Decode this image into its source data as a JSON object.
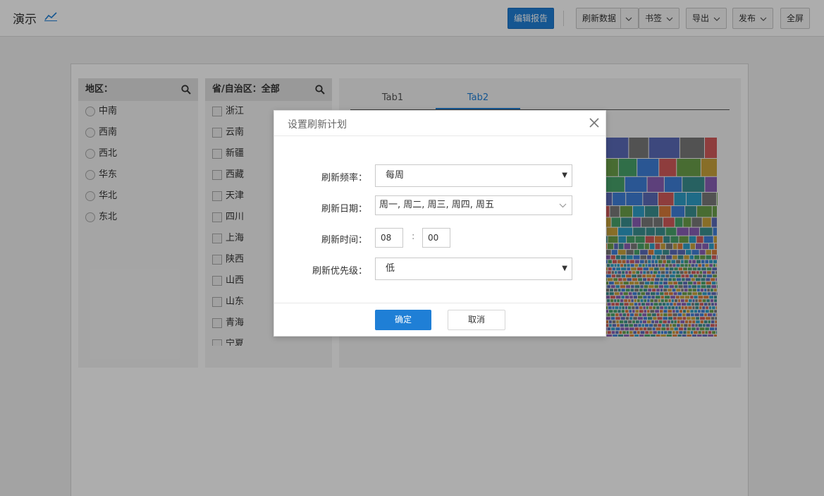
{
  "header": {
    "title": "演示",
    "buttons": {
      "edit_report": "编辑报告",
      "refresh_data": "刷新数据",
      "bookmark": "书签",
      "export": "导出",
      "publish": "发布",
      "fullscreen": "全屏"
    }
  },
  "filters": {
    "region": {
      "title": "地区：",
      "options": [
        "中南",
        "西南",
        "西北",
        "华东",
        "华北",
        "东北"
      ]
    },
    "province": {
      "title": "省/自治区：全部",
      "options": [
        "浙江",
        "云南",
        "新疆",
        "西藏",
        "天津",
        "四川",
        "上海",
        "陕西",
        "山西",
        "山东",
        "青海",
        "宁夏"
      ]
    }
  },
  "tabs": [
    "Tab1",
    "Tab2"
  ],
  "active_tab": "Tab2",
  "dialog": {
    "title": "设置刷新计划",
    "frequency_label": "刷新频率：",
    "frequency_value": "每周",
    "date_label": "刷新日期：",
    "date_value": "周一, 周二, 周三, 周四, 周五",
    "time_label": "刷新时间：",
    "hour": "08",
    "minute": "00",
    "priority_label": "刷新优先级：",
    "priority_value": "低",
    "ok": "确定",
    "cancel": "取消"
  },
  "colors": {
    "accent": "#1f7fd6",
    "treemap_palette": [
      "#3f7fd9",
      "#5b6bb8",
      "#47a36b",
      "#c9a33b",
      "#d25a5a",
      "#3a8f8f",
      "#8a5fb5",
      "#6b9f4a",
      "#2f9ec7",
      "#d97b3a",
      "#7a7a7a"
    ]
  }
}
